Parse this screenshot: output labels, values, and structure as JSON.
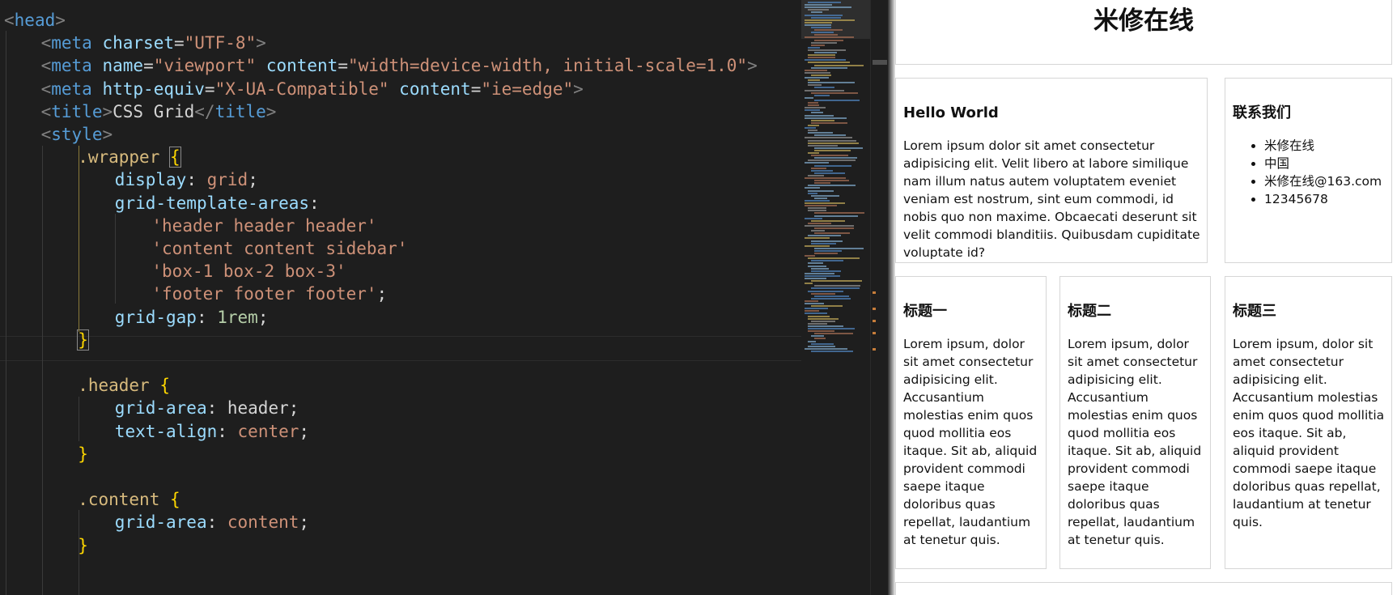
{
  "editor": {
    "code_lines": [
      [
        [
          "tk-punct",
          "<"
        ],
        [
          "tk-tag",
          "head"
        ],
        [
          "tk-punct",
          ">"
        ]
      ],
      [
        [
          "tk-punct",
          "<"
        ],
        [
          "tk-tag",
          "meta"
        ],
        [
          "tk-text",
          " "
        ],
        [
          "tk-attr",
          "charset"
        ],
        [
          "tk-text",
          "="
        ],
        [
          "tk-str",
          "\"UTF-8\""
        ],
        [
          "tk-punct",
          ">"
        ]
      ],
      [
        [
          "tk-punct",
          "<"
        ],
        [
          "tk-tag",
          "meta"
        ],
        [
          "tk-text",
          " "
        ],
        [
          "tk-attr",
          "name"
        ],
        [
          "tk-text",
          "="
        ],
        [
          "tk-str",
          "\"viewport\""
        ],
        [
          "tk-text",
          " "
        ],
        [
          "tk-attr",
          "content"
        ],
        [
          "tk-text",
          "="
        ],
        [
          "tk-str",
          "\"width=device-width, initial-scale=1.0\""
        ],
        [
          "tk-punct",
          ">"
        ]
      ],
      [
        [
          "tk-punct",
          "<"
        ],
        [
          "tk-tag",
          "meta"
        ],
        [
          "tk-text",
          " "
        ],
        [
          "tk-attr",
          "http-equiv"
        ],
        [
          "tk-text",
          "="
        ],
        [
          "tk-str",
          "\"X-UA-Compatible\""
        ],
        [
          "tk-text",
          " "
        ],
        [
          "tk-attr",
          "content"
        ],
        [
          "tk-text",
          "="
        ],
        [
          "tk-str",
          "\"ie=edge\""
        ],
        [
          "tk-punct",
          ">"
        ]
      ],
      [
        [
          "tk-punct",
          "<"
        ],
        [
          "tk-tag",
          "title"
        ],
        [
          "tk-punct",
          ">"
        ],
        [
          "tk-text",
          "CSS Grid"
        ],
        [
          "tk-punct",
          "</"
        ],
        [
          "tk-tag",
          "title"
        ],
        [
          "tk-punct",
          ">"
        ]
      ],
      [
        [
          "tk-punct",
          "<"
        ],
        [
          "tk-tag",
          "style"
        ],
        [
          "tk-punct",
          ">"
        ]
      ],
      [
        [
          "tk-sel",
          ".wrapper "
        ],
        [
          "tk-brace",
          "{"
        ]
      ],
      [
        [
          "tk-prop",
          "display"
        ],
        [
          "tk-text",
          ": "
        ],
        [
          "tk-str",
          "grid"
        ],
        [
          "tk-text",
          ";"
        ]
      ],
      [
        [
          "tk-prop",
          "grid-template-areas"
        ],
        [
          "tk-text",
          ":"
        ]
      ],
      [
        [
          "tk-str",
          "'header header header'"
        ]
      ],
      [
        [
          "tk-str",
          "'content content sidebar'"
        ]
      ],
      [
        [
          "tk-str",
          "'box-1 box-2 box-3'"
        ]
      ],
      [
        [
          "tk-str",
          "'footer footer footer'"
        ],
        [
          "tk-text",
          ";"
        ]
      ],
      [
        [
          "tk-prop",
          "grid-gap"
        ],
        [
          "tk-text",
          ": "
        ],
        [
          "tk-num",
          "1rem"
        ],
        [
          "tk-text",
          ";"
        ]
      ],
      [
        [
          "tk-brace",
          "}"
        ]
      ],
      [],
      [
        [
          "tk-sel",
          ".header "
        ],
        [
          "tk-brace",
          "{"
        ]
      ],
      [
        [
          "tk-prop",
          "grid-area"
        ],
        [
          "tk-text",
          ": header;"
        ]
      ],
      [
        [
          "tk-prop",
          "text-align"
        ],
        [
          "tk-text",
          ": "
        ],
        [
          "tk-str",
          "center"
        ],
        [
          "tk-text",
          ";"
        ]
      ],
      [
        [
          "tk-brace",
          "}"
        ]
      ],
      [],
      [
        [
          "tk-sel",
          ".content "
        ],
        [
          "tk-brace",
          "{"
        ]
      ],
      [
        [
          "tk-prop",
          "grid-area"
        ],
        [
          "tk-text",
          ": "
        ],
        [
          "tk-str",
          "content"
        ],
        [
          "tk-text",
          ";"
        ]
      ],
      [
        [
          "tk-brace",
          "}"
        ]
      ]
    ]
  },
  "preview": {
    "header": {
      "title": "米修在线"
    },
    "content": {
      "heading": "Hello World",
      "body": "Lorem ipsum dolor sit amet consectetur adipisicing elit. Velit libero at labore similique nam illum natus autem voluptatem eveniet veniam est nostrum, sint eum commodi, id nobis quo non maxime. Obcaecati deserunt sit velit commodi blanditiis. Quibusdam cupiditate voluptate id?"
    },
    "sidebar": {
      "heading": "联系我们",
      "items": [
        "米修在线",
        "中国",
        "米修在线@163.com",
        "12345678"
      ]
    },
    "boxes": [
      {
        "heading": "标题一",
        "body": "Lorem ipsum, dolor sit amet consectetur adipisicing elit. Accusantium molestias enim quos quod mollitia eos itaque. Sit ab, aliquid provident commodi saepe itaque doloribus quas repellat, laudantium at tenetur quis."
      },
      {
        "heading": "标题二",
        "body": "Lorem ipsum, dolor sit amet consectetur adipisicing elit. Accusantium molestias enim quos quod mollitia eos itaque. Sit ab, aliquid provident commodi saepe itaque doloribus quas repellat, laudantium at tenetur quis."
      },
      {
        "heading": "标题三",
        "body": "Lorem ipsum, dolor sit amet consectetur adipisicing elit. Accusantium molestias enim quos quod mollitia eos itaque. Sit ab, aliquid provident commodi saepe itaque doloribus quas repellat, laudantium at tenetur quis."
      }
    ]
  }
}
